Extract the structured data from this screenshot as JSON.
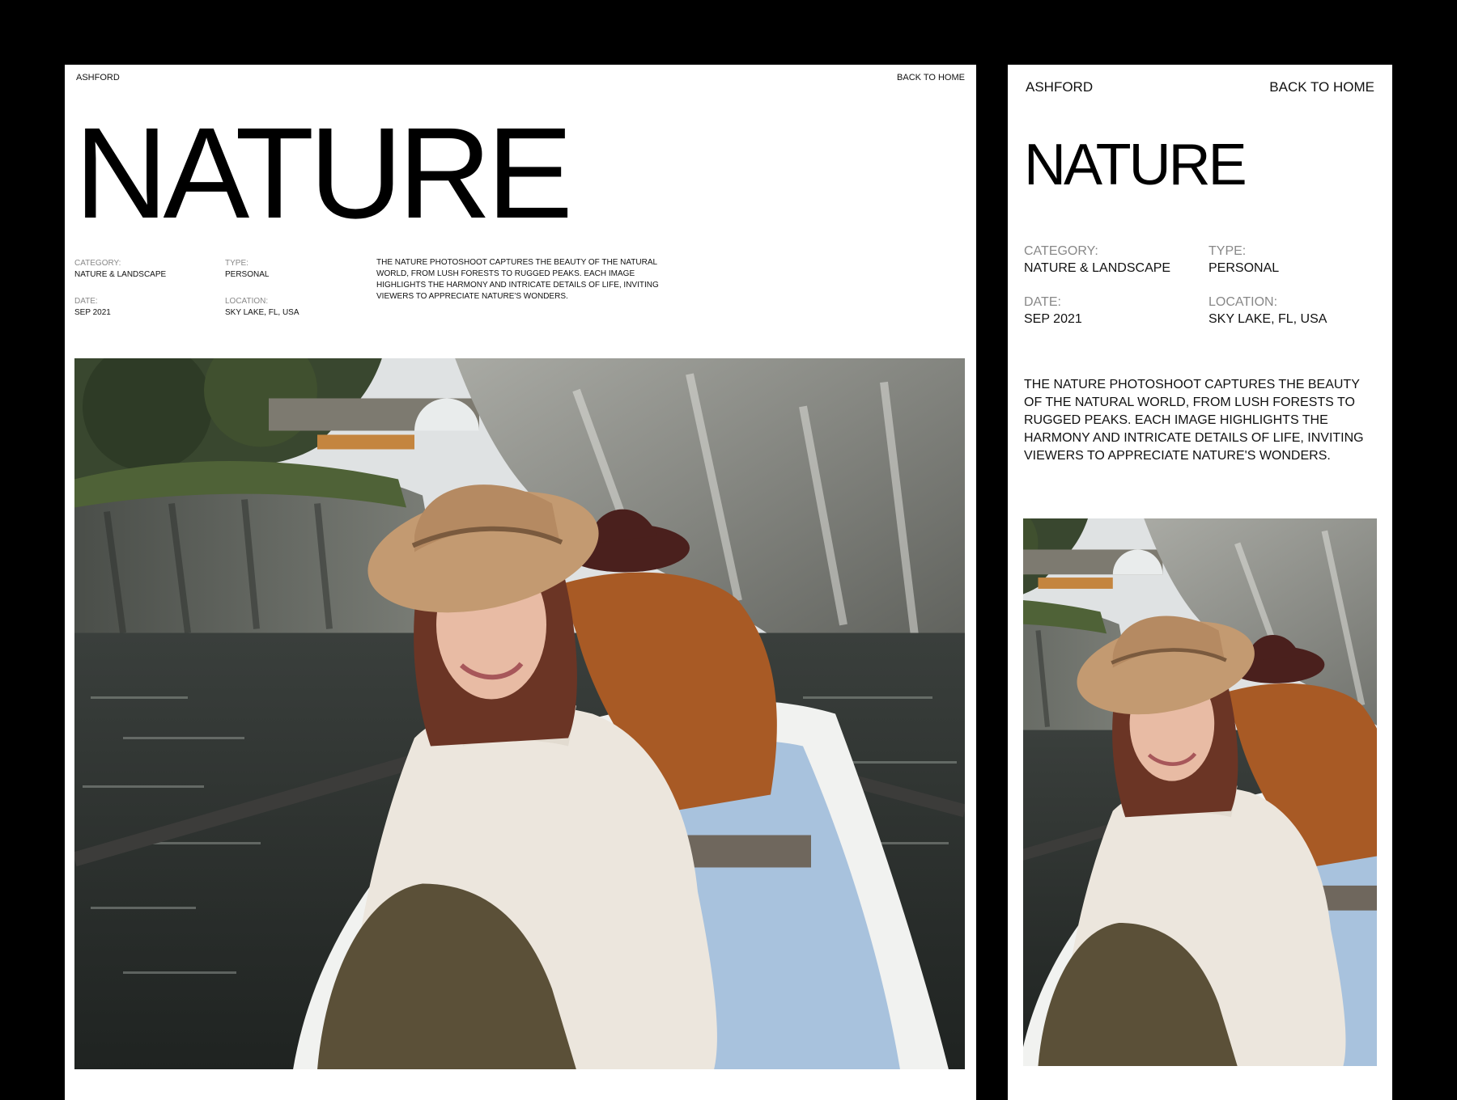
{
  "brand": "ASHFORD",
  "nav": {
    "back_label": "BACK TO HOME"
  },
  "page": {
    "title": "NATURE"
  },
  "meta": {
    "category": {
      "label": "CATEGORY:",
      "value": "NATURE & LANDSCAPE"
    },
    "type": {
      "label": "TYPE:",
      "value": "PERSONAL"
    },
    "date": {
      "label": "DATE:",
      "value": "SEP 2021"
    },
    "location": {
      "label": "LOCATION:",
      "value": "SKY LAKE, FL, USA"
    }
  },
  "description": "THE NATURE PHOTOSHOOT CAPTURES THE BEAUTY OF THE NATURAL WORLD, FROM LUSH FORESTS TO RUGGED PEAKS. EACH IMAGE HIGHLIGHTS THE HARMONY AND INTRICATE DETAILS OF LIFE, INVITING VIEWERS TO APPRECIATE NATURE'S WONDERS.",
  "colors": {
    "background": "#000000",
    "panel": "#ffffff",
    "label": "#888888",
    "text": "#111111"
  }
}
